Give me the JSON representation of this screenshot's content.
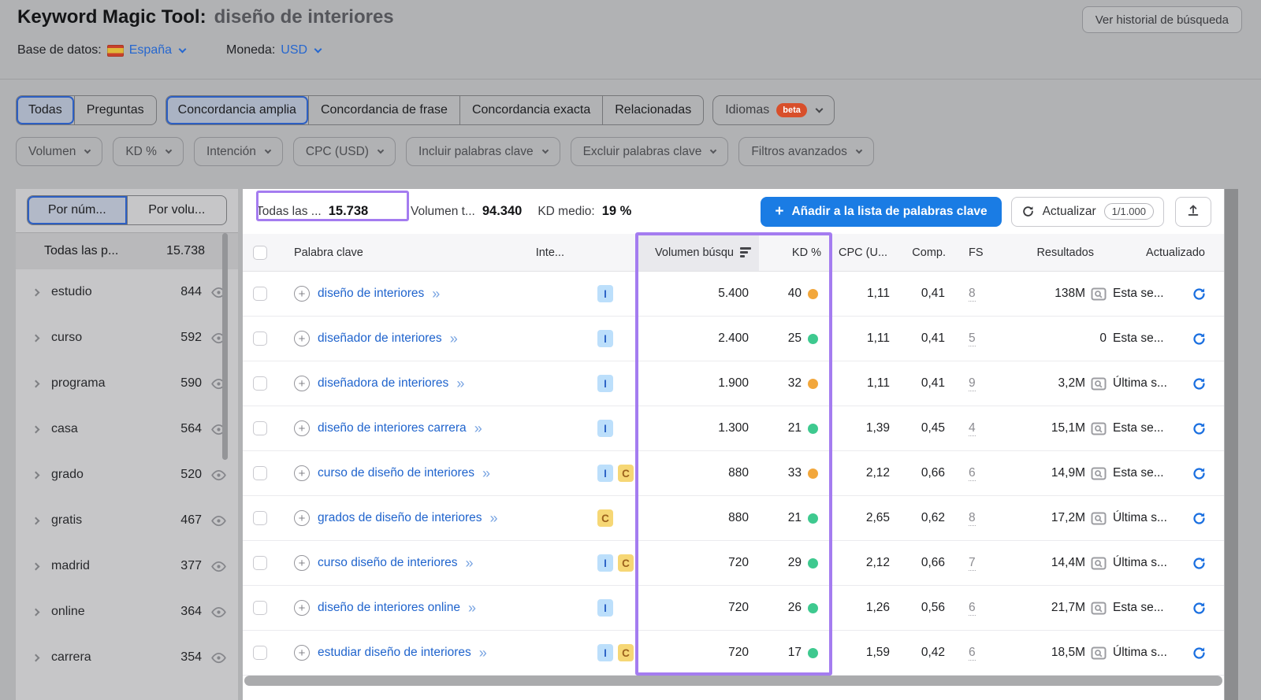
{
  "header": {
    "title": "Keyword Magic Tool:",
    "query": "diseño de interiores",
    "history_button": "Ver historial de búsqueda",
    "database_label": "Base de datos:",
    "database_value": "España",
    "currency_label": "Moneda:",
    "currency_value": "USD"
  },
  "tabs": {
    "group1": [
      {
        "label": "Todas",
        "selected": true
      },
      {
        "label": "Preguntas",
        "selected": false
      }
    ],
    "group2": [
      {
        "label": "Concordancia amplia",
        "selected": true
      },
      {
        "label": "Concordancia de frase",
        "selected": false
      },
      {
        "label": "Concordancia exacta",
        "selected": false
      },
      {
        "label": "Relacionadas",
        "selected": false
      }
    ],
    "languages": {
      "label": "Idiomas",
      "badge": "beta"
    }
  },
  "filters": [
    "Volumen",
    "KD %",
    "Intención",
    "CPC (USD)",
    "Incluir palabras clave",
    "Excluir palabras clave",
    "Filtros avanzados"
  ],
  "sidebar": {
    "toggle": [
      "Por núm...",
      "Por volu..."
    ],
    "all_row": {
      "label": "Todas las p...",
      "count": "15.738"
    },
    "groups": [
      {
        "name": "estudio",
        "count": "844"
      },
      {
        "name": "curso",
        "count": "592"
      },
      {
        "name": "programa",
        "count": "590"
      },
      {
        "name": "casa",
        "count": "564"
      },
      {
        "name": "grado",
        "count": "520"
      },
      {
        "name": "gratis",
        "count": "467"
      },
      {
        "name": "madrid",
        "count": "377"
      },
      {
        "name": "online",
        "count": "364"
      },
      {
        "name": "carrera",
        "count": "354"
      }
    ]
  },
  "toolbar": {
    "all_label": "Todas las ...",
    "all_value": "15.738",
    "volume_label": "Volumen t...",
    "volume_value": "94.340",
    "kd_label": "KD medio:",
    "kd_value": "19 %",
    "add_plus": "+",
    "add_button": "Añadir a la lista de palabras clave",
    "update_button": "Actualizar",
    "update_counter": "1/1.000"
  },
  "table": {
    "headers": {
      "keyword": "Palabra clave",
      "intent": "Inte...",
      "volume": "Volumen búsqu",
      "kd": "KD %",
      "cpc": "CPC (U...",
      "comp": "Comp.",
      "fs": "FS",
      "results": "Resultados",
      "updated": "Actualizado"
    },
    "rows": [
      {
        "keyword": "diseño de interiores",
        "intents": [
          "I"
        ],
        "volume": "5.400",
        "kd": "40",
        "kd_color": "orange",
        "cpc": "1,11",
        "comp": "0,41",
        "fs": "8",
        "results": "138M",
        "updated": "Esta se..."
      },
      {
        "keyword": "diseñador de interiores",
        "intents": [
          "I"
        ],
        "volume": "2.400",
        "kd": "25",
        "kd_color": "green",
        "cpc": "1,11",
        "comp": "0,41",
        "fs": "5",
        "results": "0",
        "updated": "Esta se..."
      },
      {
        "keyword": "diseñadora de interiores",
        "intents": [
          "I"
        ],
        "volume": "1.900",
        "kd": "32",
        "kd_color": "orange",
        "cpc": "1,11",
        "comp": "0,41",
        "fs": "9",
        "results": "3,2M",
        "updated": "Última s..."
      },
      {
        "keyword": "diseño de interiores carrera",
        "intents": [
          "I"
        ],
        "volume": "1.300",
        "kd": "21",
        "kd_color": "green",
        "cpc": "1,39",
        "comp": "0,45",
        "fs": "4",
        "results": "15,1M",
        "updated": "Esta se..."
      },
      {
        "keyword": "curso de diseño de interiores",
        "intents": [
          "I",
          "C"
        ],
        "volume": "880",
        "kd": "33",
        "kd_color": "orange",
        "cpc": "2,12",
        "comp": "0,66",
        "fs": "6",
        "results": "14,9M",
        "updated": "Esta se..."
      },
      {
        "keyword": "grados de diseño de interiores",
        "intents": [
          "C"
        ],
        "volume": "880",
        "kd": "21",
        "kd_color": "green",
        "cpc": "2,65",
        "comp": "0,62",
        "fs": "8",
        "results": "17,2M",
        "updated": "Última s..."
      },
      {
        "keyword": "curso diseño de interiores",
        "intents": [
          "I",
          "C"
        ],
        "volume": "720",
        "kd": "29",
        "kd_color": "green",
        "cpc": "2,12",
        "comp": "0,66",
        "fs": "7",
        "results": "14,4M",
        "updated": "Última s..."
      },
      {
        "keyword": "diseño de interiores online",
        "intents": [
          "I"
        ],
        "volume": "720",
        "kd": "26",
        "kd_color": "green",
        "cpc": "1,26",
        "comp": "0,56",
        "fs": "6",
        "results": "21,7M",
        "updated": "Esta se..."
      },
      {
        "keyword": "estudiar diseño de interiores",
        "intents": [
          "I",
          "C"
        ],
        "volume": "720",
        "kd": "17",
        "kd_color": "green",
        "cpc": "1,59",
        "comp": "0,42",
        "fs": "6",
        "results": "18,5M",
        "updated": "Última s..."
      }
    ]
  },
  "colors": {
    "highlight_purple": "#A47CF0",
    "accent_blue": "#1A7CE4",
    "kd_orange": "#F2A73C",
    "kd_green": "#3EC98F",
    "beta_orange": "#D84F2B"
  }
}
